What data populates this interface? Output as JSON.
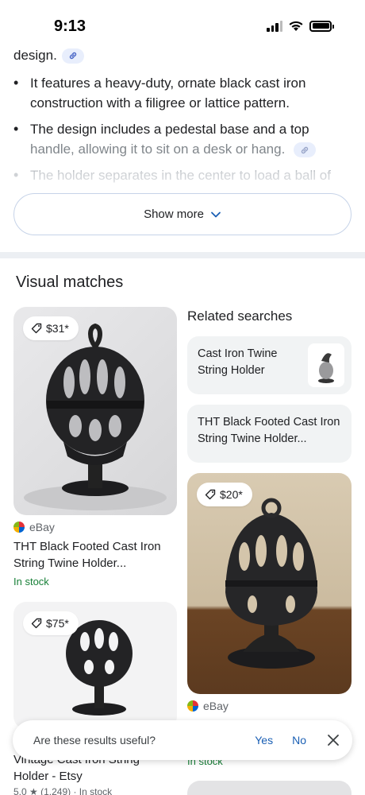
{
  "status_bar": {
    "time": "9:13"
  },
  "ai_overview": {
    "top_fragment": "design.",
    "bullets": [
      {
        "text": "It features a heavy-duty, ornate black cast iron construction with a filigree or lattice pattern."
      },
      {
        "text_main": "The design includes a pedestal base and a top ",
        "text_faded": "handle, allowing it to sit on a desk or hang."
      },
      {
        "text": "The holder separates in the center to load a ball of"
      }
    ],
    "show_more_label": "Show more"
  },
  "visual_matches": {
    "title": "Visual matches",
    "left_column": [
      {
        "price": "$31*",
        "source": "eBay",
        "title": "THT Black Footed Cast Iron String Twine Holder...",
        "stock": "In stock"
      },
      {
        "price": "$75*",
        "title_partial": "Vintage Cast Iron String",
        "title_line2": "Holder - Etsy",
        "rating": "5.0 ★ (1,249) · In stock"
      }
    ],
    "related": {
      "title": "Related searches",
      "items": [
        {
          "label": "Cast Iron Twine String Holder"
        },
        {
          "label": "THT Black Footed Cast Iron String Twine Holder..."
        }
      ]
    },
    "right_column": [
      {
        "price": "$20*",
        "source": "eBay",
        "stock": "In stock"
      }
    ]
  },
  "feedback": {
    "question": "Are these results useful?",
    "yes": "Yes",
    "no": "No"
  }
}
